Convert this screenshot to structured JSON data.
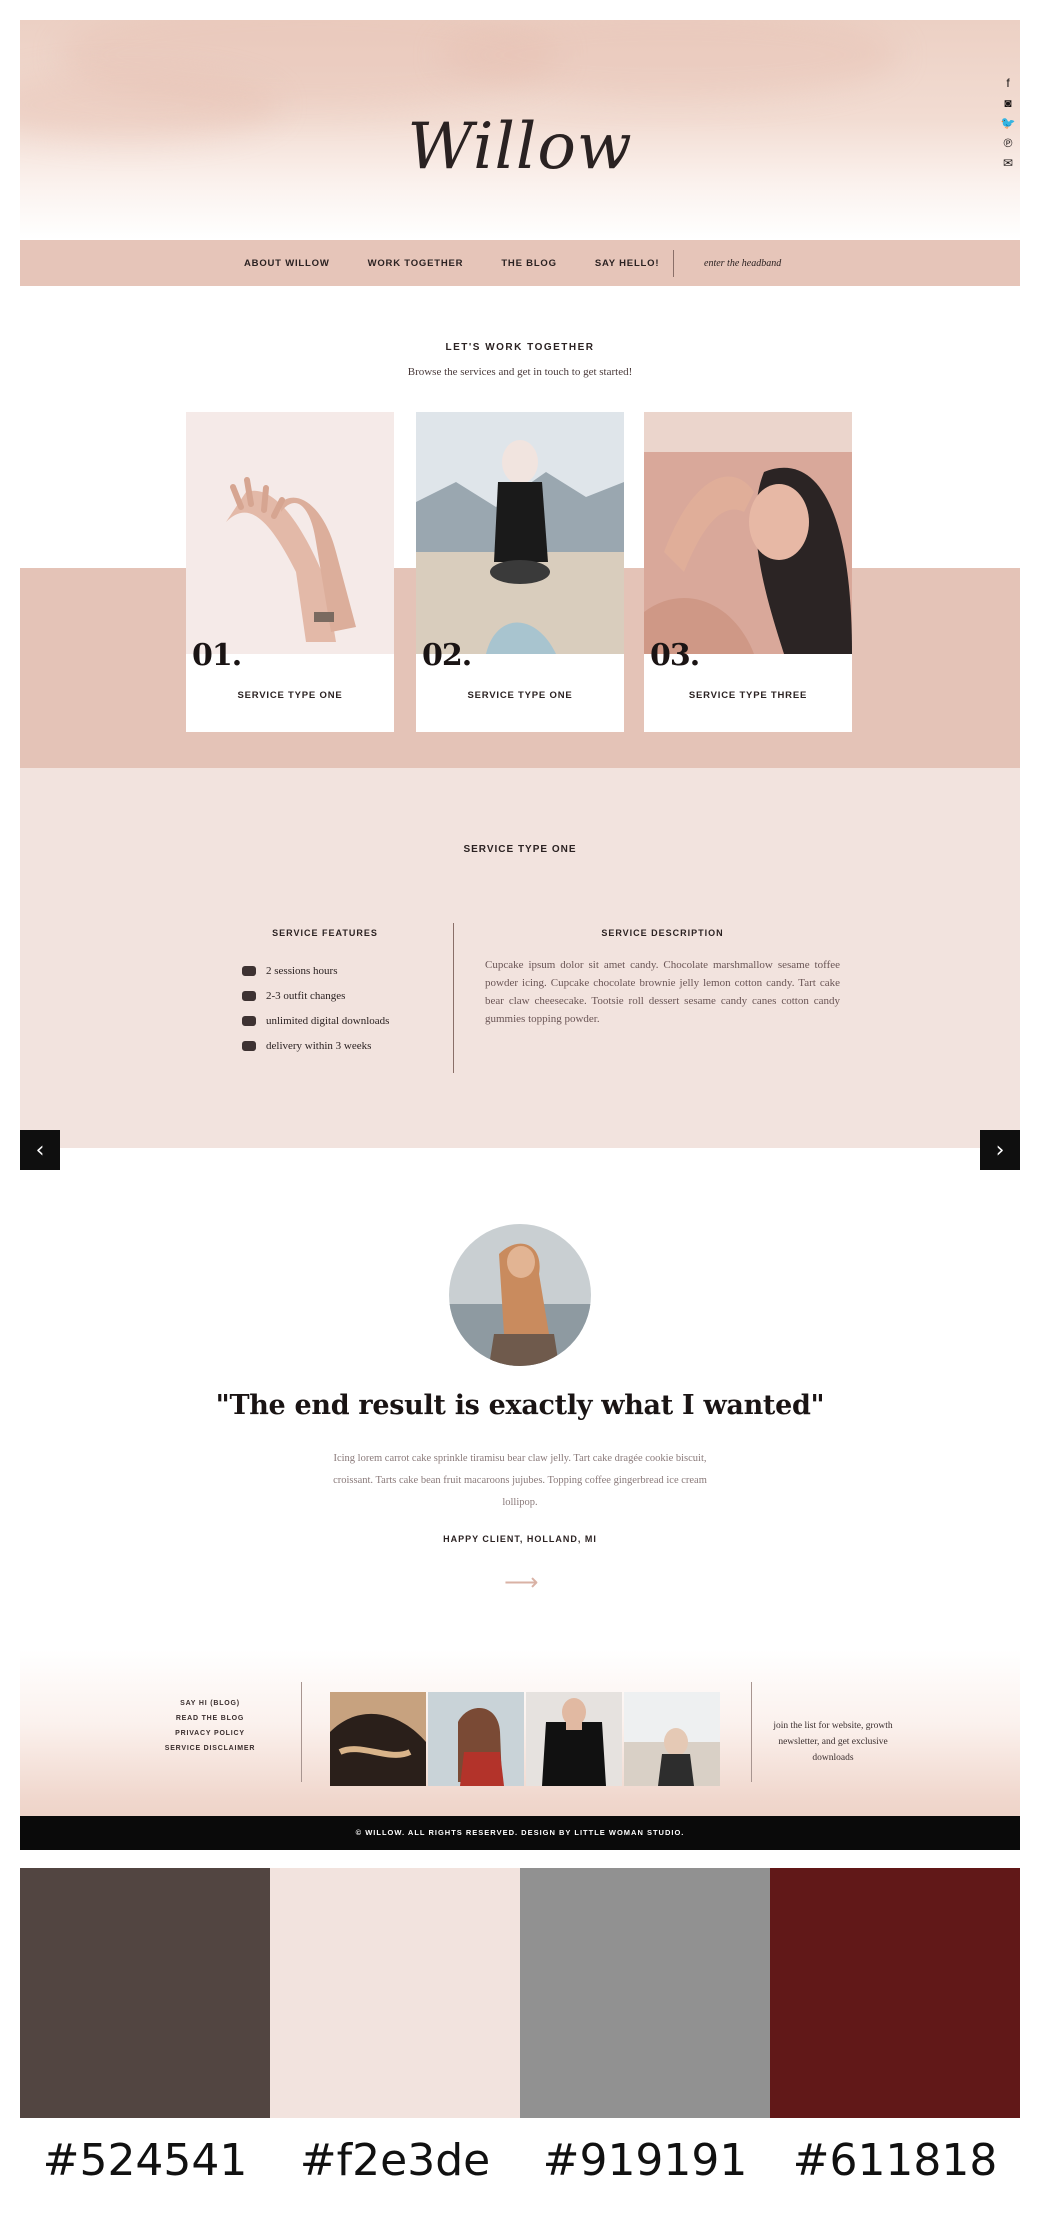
{
  "site": {
    "logo": "Willow",
    "social_icons": [
      "facebook-icon",
      "instagram-icon",
      "twitter-icon",
      "pinterest-icon",
      "email-icon"
    ]
  },
  "nav": {
    "items": [
      "ABOUT WILLOW",
      "WORK TOGETHER",
      "THE BLOG",
      "SAY HELLO!"
    ],
    "search_placeholder": "enter the headband"
  },
  "intro": {
    "title": "LET'S WORK TOGETHER",
    "subtitle": "Browse the services and get in touch to get started!"
  },
  "services": [
    {
      "number": "01.",
      "label": "SERVICE TYPE ONE"
    },
    {
      "number": "02.",
      "label": "SERVICE TYPE ONE"
    },
    {
      "number": "03.",
      "label": "SERVICE TYPE THREE"
    }
  ],
  "service_detail": {
    "title": "SERVICE TYPE ONE",
    "features_heading": "SERVICE FEATURES",
    "features": [
      "2 sessions hours",
      "2-3 outfit changes",
      "unlimited digital downloads",
      "delivery within 3 weeks"
    ],
    "description_heading": "SERVICE DESCRIPTION",
    "description": "Cupcake ipsum dolor sit amet candy. Chocolate marshmallow sesame toffee powder icing. Cupcake chocolate brownie jelly lemon cotton candy. Tart cake bear claw cheesecake. Tootsie roll dessert sesame candy canes cotton candy gummies topping powder.",
    "prev_icon": "chevron-left-icon",
    "next_icon": "chevron-right-icon"
  },
  "testimonial": {
    "quote": "\"The end result is exactly what I wanted\"",
    "body": "Icing lorem carrot cake sprinkle tiramisu bear claw jelly. Tart cake dragée cookie biscuit, croissant. Tarts cake bean fruit macaroons jujubes. Topping coffee gingerbread ice cream lollipop.",
    "author": "HAPPY CLIENT, HOLLAND, MI",
    "arrow_icon": "arrow-right-icon"
  },
  "footer": {
    "links": [
      "SAY HI (BLOG)",
      "READ THE BLOG",
      "PRIVACY POLICY",
      "SERVICE DISCLAIMER"
    ],
    "note": "join the list for website, growth newsletter, and get exclusive downloads",
    "copyright": "© WILLOW. ALL RIGHTS RESERVED. DESIGN BY LITTLE WOMAN STUDIO."
  },
  "palette": [
    {
      "hex": "#524541",
      "label": "#524541"
    },
    {
      "hex": "#f2e3de",
      "label": "#f2e3de"
    },
    {
      "hex": "#919191",
      "label": "#919191"
    },
    {
      "hex": "#611818",
      "label": "#611818"
    }
  ]
}
